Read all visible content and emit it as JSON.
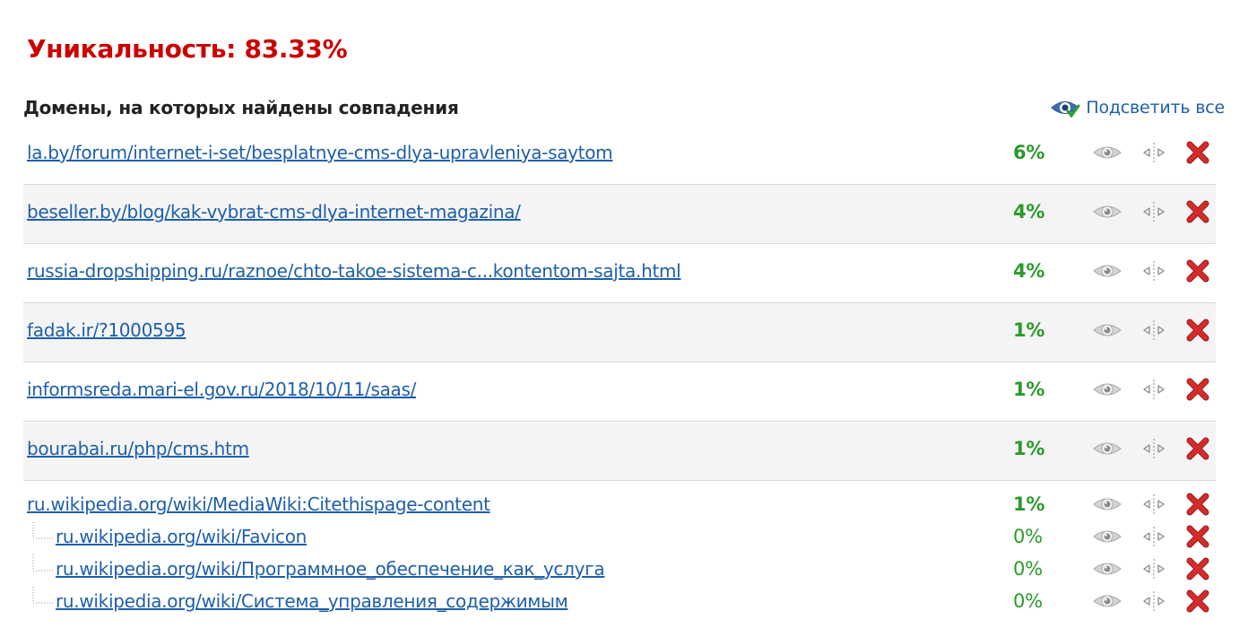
{
  "uniqueness": {
    "title": "Уникальность: 83.33%"
  },
  "heading": "Домены, на которых найдены совпадения",
  "highlight_all": {
    "label": "Подсветить все"
  },
  "colors": {
    "title": "#cc0000",
    "link": "#1f5fa8",
    "percent": "#2a9a2a",
    "delete": "#d62b2b"
  },
  "icons": {
    "show": "eye-icon",
    "compare": "split-icon",
    "remove": "delete-x-icon"
  },
  "rows": [
    {
      "url": "la.by/forum/internet-i-set/besplatnye-cms-dlya-upravleniya-saytom",
      "percent": "6%"
    },
    {
      "url": "beseller.by/blog/kak-vybrat-cms-dlya-internet-magazina/",
      "percent": "4%"
    },
    {
      "url": "russia-dropshipping.ru/raznoe/chto-takoe-sistema-c...kontentom-sajta.html",
      "percent": "4%"
    },
    {
      "url": "fadak.ir/?1000595",
      "percent": "1%"
    },
    {
      "url": "informsreda.mari-el.gov.ru/2018/10/11/saas/",
      "percent": "1%"
    },
    {
      "url": "bourabai.ru/php/cms.htm",
      "percent": "1%"
    }
  ],
  "group": {
    "url": "ru.wikipedia.org/wiki/MediaWiki:Citethispage-content",
    "percent": "1%",
    "children": [
      {
        "url": "ru.wikipedia.org/wiki/Favicon",
        "percent": "0%"
      },
      {
        "url": "ru.wikipedia.org/wiki/Программное_обеспечение_как_услуга",
        "percent": "0%"
      },
      {
        "url": "ru.wikipedia.org/wiki/Система_управления_содержимым",
        "percent": "0%"
      }
    ]
  }
}
